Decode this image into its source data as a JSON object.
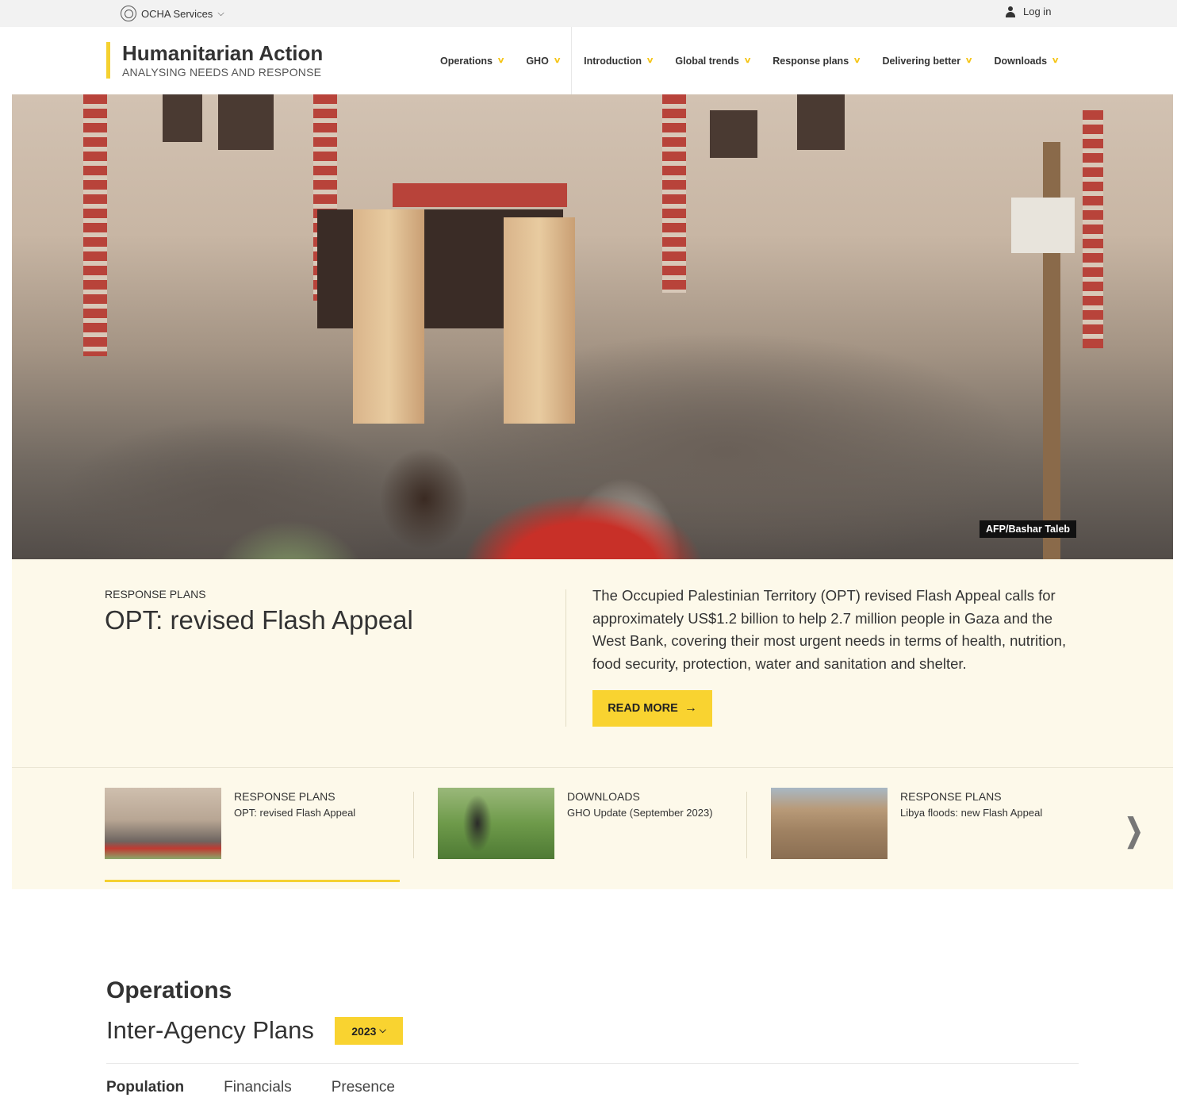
{
  "topbar": {
    "ocha_services": "OCHA Services",
    "login": "Log in"
  },
  "brand": {
    "title": "Humanitarian Action",
    "subtitle": "ANALYSING NEEDS AND RESPONSE",
    "accent_color": "#f5d130"
  },
  "nav": {
    "items": [
      {
        "label": "Operations"
      },
      {
        "label": "GHO"
      },
      {
        "label": "Introduction"
      },
      {
        "label": "Global trends"
      },
      {
        "label": "Response plans"
      },
      {
        "label": "Delivering better"
      },
      {
        "label": "Downloads"
      }
    ]
  },
  "hero": {
    "photo_credit": "AFP/Bashar Taleb"
  },
  "feature": {
    "category": "RESPONSE PLANS",
    "title": "OPT: revised Flash Appeal",
    "body": "The Occupied Palestinian Territory (OPT) revised Flash Appeal calls for approximately US$1.2 billion to help 2.7 million people in Gaza and the West Bank, covering their most urgent needs in terms of health, nutrition, food security, protection, water and sanitation and shelter.",
    "cta": "READ MORE",
    "background": "#fdf9ea",
    "button_color": "#f9d330"
  },
  "carousel": {
    "slides": [
      {
        "category": "RESPONSE PLANS",
        "title": "OPT: revised Flash Appeal"
      },
      {
        "category": "DOWNLOADS",
        "title": "GHO Update (September 2023)"
      },
      {
        "category": "RESPONSE PLANS",
        "title": "Libya floods: new Flash Appeal"
      }
    ],
    "active_index": 0
  },
  "operations": {
    "heading": "Operations",
    "subheading": "Inter-Agency Plans",
    "year": "2023",
    "tabs": [
      {
        "label": "Population",
        "active": true
      },
      {
        "label": "Financials",
        "active": false
      },
      {
        "label": "Presence",
        "active": false
      }
    ]
  }
}
